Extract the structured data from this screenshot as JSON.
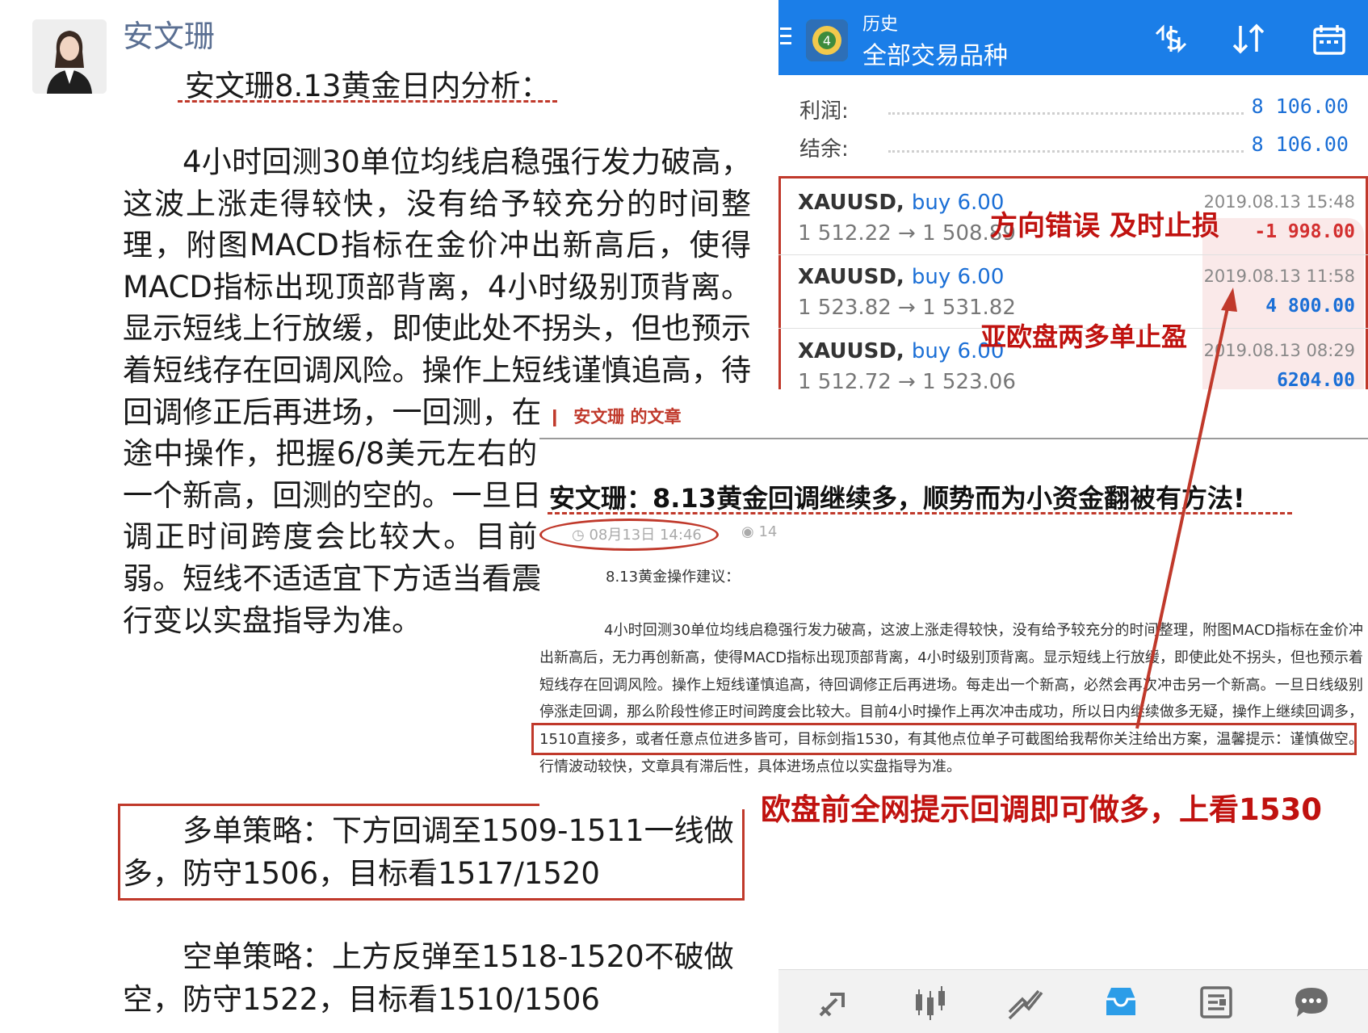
{
  "chat": {
    "sender": "安文珊",
    "title": "安文珊8.13黄金日内分析：",
    "body": "4小时回测30单位均线启稳强行发力破高，这波上涨走得较快，没有给予较充分的时间整理，附图MACD指标在金价冲出新高后，使得MACD指标出现顶部背离，4小时级别顶背离。显示短线上行放缓，即使此处不拐头，但也预示着短线存在回调风险。操作上短线谨慎追高，待回调修正后再进场，一回测，在连续惯性的刷高途中操作，把握6/8美元左右的空间战。每走出一个新高，回测的空的。一旦日线级别停涨走回调正时间跨度会比较大。目前4小上行量能减弱。短线不适适宜下方适当看震荡修正，破位另行变以实盘指导为准。",
    "long_strategy": "多单策略：下方回调至1509-1511一线做多，防守1506，目标看1517/1520",
    "short_strategy": "空单策略：上方反弹至1518-1520不破做空，防守1522，目标看1510/1506"
  },
  "mt4": {
    "header_title": "历史",
    "header_subtitle": "全部交易品种",
    "summary": [
      {
        "label": "利润:",
        "value": "8 106.00"
      },
      {
        "label": "结余:",
        "value": "8 106.00"
      }
    ],
    "trades": [
      {
        "symbol": "XAUUSD,",
        "side": "buy 6.00",
        "prices": "1 512.22 → 1 508.89",
        "time": "2019.08.13 15:48",
        "profit": "-1 998.00",
        "negative": true
      },
      {
        "symbol": "XAUUSD,",
        "side": "buy 6.00",
        "prices": "1 523.82 → 1 531.82",
        "time": "2019.08.13 11:58",
        "profit": "4 800.00",
        "negative": false
      },
      {
        "symbol": "XAUUSD,",
        "side": "buy 6.00",
        "prices": "1 512.72 → 1 523.06",
        "time": "2019.08.13 08:29",
        "profit": "6204.00",
        "negative": false
      }
    ],
    "icons": {
      "header": [
        "currency-exchange-icon",
        "sort-icon",
        "calendar-icon"
      ],
      "nav": [
        "trade-icon",
        "candles-icon",
        "chart-icon",
        "history-icon",
        "news-icon",
        "chat-icon"
      ]
    }
  },
  "annotations": {
    "stop_loss": "方向错误 及时止损",
    "take_profit": "亚欧盘两多单止盈",
    "callout": "欧盘前全网提示回调即可做多，上看1530"
  },
  "overlay": {
    "tag": "安文珊 的文章",
    "title": "安文珊：8.13黄金回调继续多，顺势而为小资金翻被有方法!",
    "date": "08月13日 14:46",
    "views": "14",
    "subtitle": "8.13黄金操作建议：",
    "body": "4小时回测30单位均线启稳强行发力破高，这波上涨走得较快，没有给予较充分的时间整理，附图MACD指标在金价冲出新高后，无力再创新高，使得MACD指标出现顶部背离，4小时级别顶背离。显示短线上行放缓，即使此处不拐头，但也预示着短线存在回调风险。操作上短线谨慎追高，待回调修正后再进场。每走出一个新高，必然会再次冲击另一个新高。一旦日线级别停涨走回调，那么阶段性修正时间跨度会比较大。目前4小时操作上再次冲击成功，所以日内继续做多无疑，操作上继续回调多，1510直接多，或者任意点位进多皆可，目标剑指1530，有其他点位单子可截图给我帮你关注给出方案，温馨提示：谨慎做空。行情波动较快，文章具有滞后性，具体进场点位以实盘指导为准。"
  }
}
